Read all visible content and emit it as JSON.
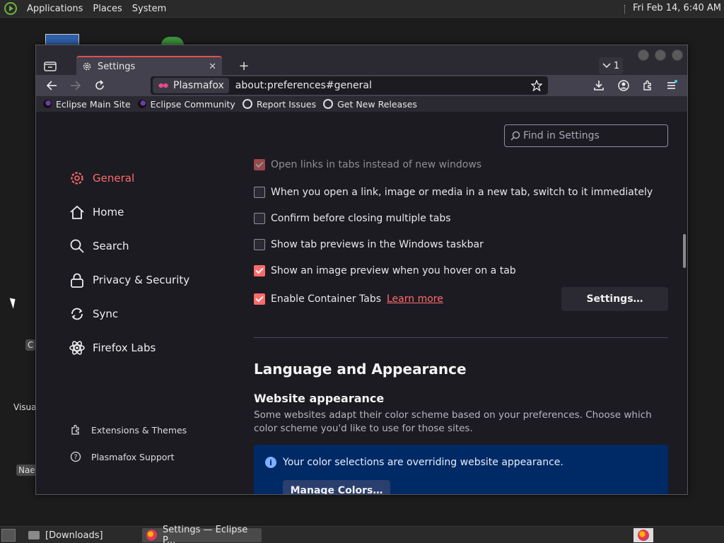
{
  "top_panel": {
    "menu": [
      "Applications",
      "Places",
      "System"
    ],
    "clock": "Fri Feb 14,  6:40 AM"
  },
  "desktop": {
    "labels": [
      "C",
      "Visua",
      "Nae"
    ]
  },
  "browser": {
    "tab": {
      "title": "Settings",
      "close": "✕"
    },
    "tab_count": "1",
    "identity_label": "Plasmafox",
    "url": "about:preferences#general",
    "bookmarks": [
      "Eclipse Main Site",
      "Eclipse Community",
      "Report Issues",
      "Get New Releases"
    ]
  },
  "settings": {
    "search_placeholder": "Find in Settings",
    "categories": [
      {
        "label": "General",
        "active": true,
        "icon": "gear-icon"
      },
      {
        "label": "Home",
        "active": false,
        "icon": "home-icon"
      },
      {
        "label": "Search",
        "active": false,
        "icon": "search-icon"
      },
      {
        "label": "Privacy & Security",
        "active": false,
        "icon": "lock-icon"
      },
      {
        "label": "Sync",
        "active": false,
        "icon": "sync-icon"
      },
      {
        "label": "Firefox Labs",
        "active": false,
        "icon": "atom-icon"
      }
    ],
    "footer_links": [
      "Extensions & Themes",
      "Plasmafox Support"
    ],
    "options": [
      {
        "label": "Open links in tabs instead of new windows",
        "checked": true
      },
      {
        "label": "When you open a link, image or media in a new tab, switch to it immediately",
        "checked": false
      },
      {
        "label": "Confirm before closing multiple tabs",
        "checked": false
      },
      {
        "label": "Show tab previews in the Windows taskbar",
        "checked": false
      },
      {
        "label": "Show an image preview when you hover on a tab",
        "checked": true
      },
      {
        "label": "Enable Container Tabs",
        "checked": true
      }
    ],
    "learn_more": "Learn more",
    "container_settings_button": "Settings…",
    "section_title": "Language and Appearance",
    "subsection_title": "Website appearance",
    "subsection_desc": "Some websites adapt their color scheme based on your preferences. Choose which color scheme you'd like to use for those sites.",
    "info_message": "Your color selections are overriding website appearance.",
    "manage_colors_button": "Manage Colors…"
  },
  "taskbar": {
    "items": [
      "[Downloads]",
      "Settings — Eclipse P..."
    ]
  },
  "colors": {
    "accent": "#ff6b6b",
    "info_bg": "#002a66"
  }
}
